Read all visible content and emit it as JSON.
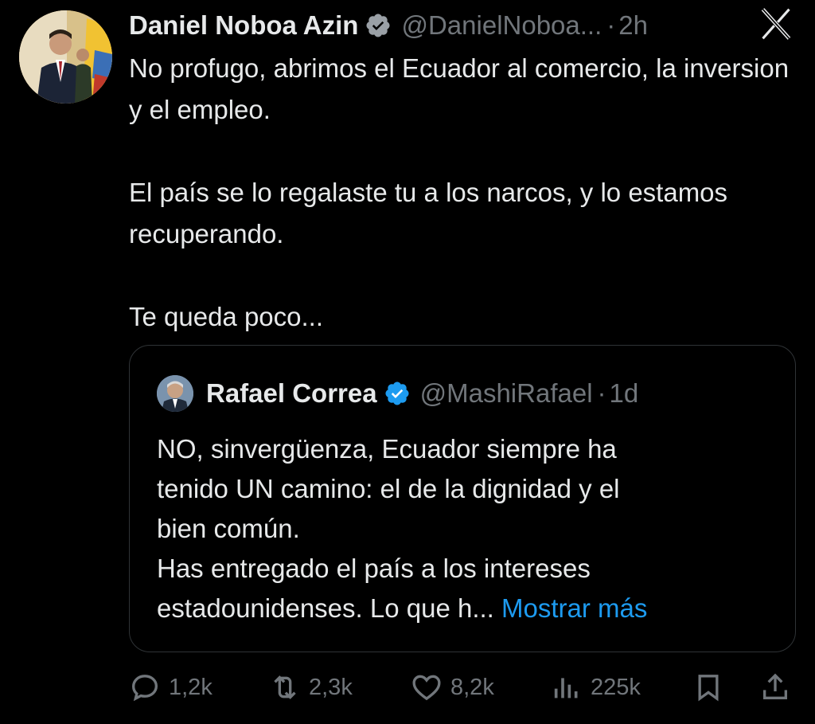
{
  "author": {
    "name": "Daniel Noboa Azin",
    "handle": "@DanielNoboa...",
    "separator": "·",
    "time": "2h",
    "avatar_icon": "profile-photo",
    "verified_icon": "verified-badge-icon"
  },
  "platform_logo": "x-logo-icon",
  "tweet": {
    "paragraphs": [
      "No profugo, abrimos el Ecuador al comercio, la inversion y el empleo.",
      "El país se lo regalaste tu a los narcos, y lo estamos recuperando.",
      "Te queda poco..."
    ]
  },
  "quoted": {
    "name": "Rafael Correa",
    "handle": "@MashiRafael",
    "separator": "·",
    "time": "1d",
    "lines": [
      "NO, sinvergüenza, Ecuador siempre ha",
      "tenido UN camino: el de la dignidad y el",
      "bien común.",
      "Has entregado el país a los intereses"
    ],
    "last_line": "estadounidenses. Lo que h...",
    "show_more": " Mostrar más"
  },
  "actions": {
    "replies": "1,2k",
    "reposts": "2,3k",
    "likes": "8,2k",
    "views": "225k"
  },
  "colors": {
    "background": "#000000",
    "text": "#e7e9ea",
    "muted": "#71767b",
    "accent": "#1d9bf0",
    "border": "#2f3336"
  }
}
